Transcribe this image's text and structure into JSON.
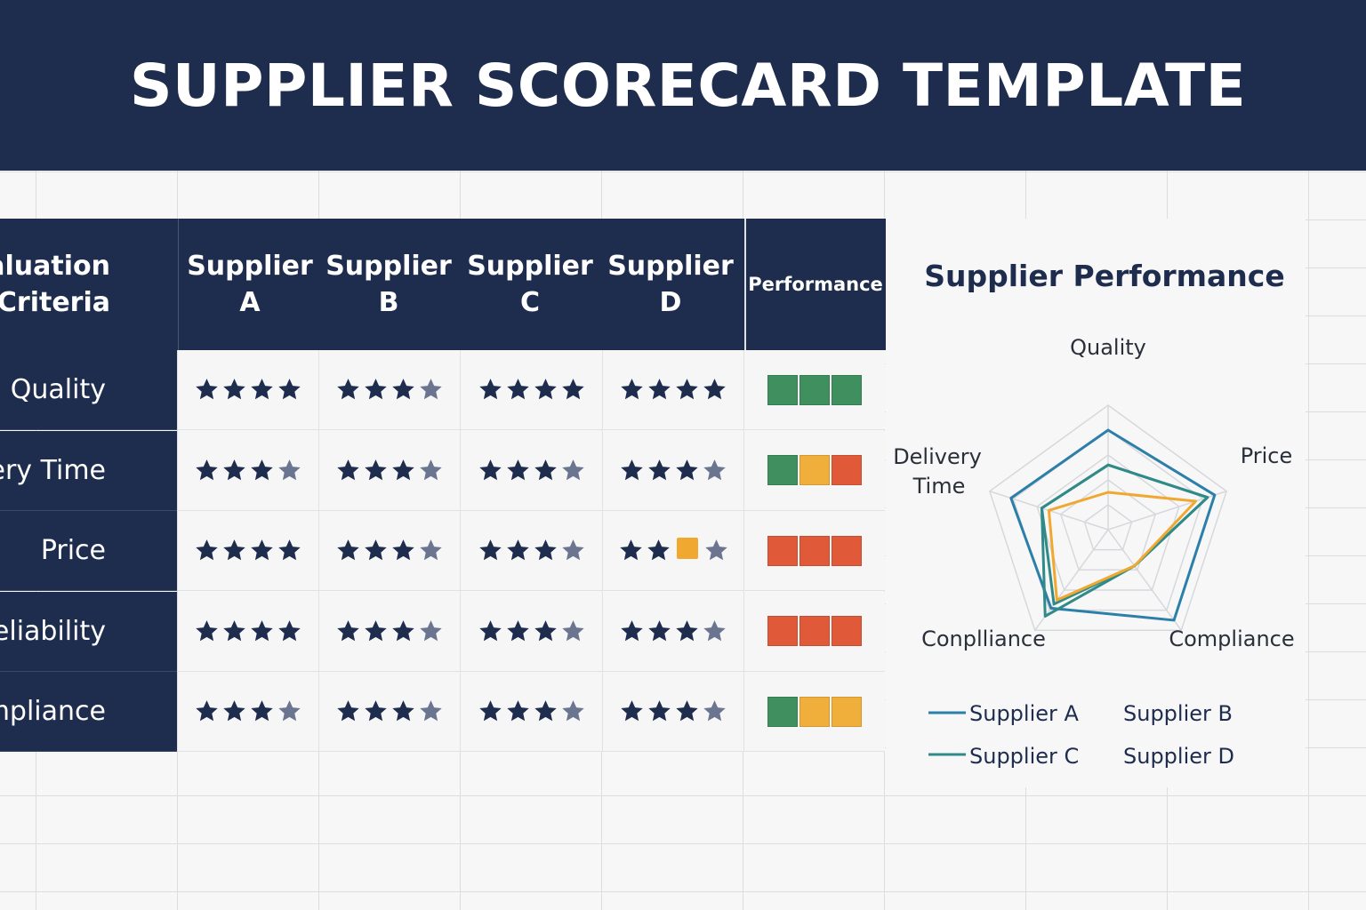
{
  "header": {
    "title": "SUPPLIER SCORECARD TEMPLATE"
  },
  "table": {
    "criteria_header": [
      "valuation",
      "Criteria"
    ],
    "suppliers": [
      {
        "line1": "Supplier",
        "line2": "A"
      },
      {
        "line1": "Supplier",
        "line2": "B"
      },
      {
        "line1": "Supplier",
        "line2": "C"
      },
      {
        "line1": "Supplier",
        "line2": "D"
      }
    ],
    "performance_header": "Performance",
    "rows": [
      {
        "label": "Quality",
        "ratings": [
          "4",
          "3.5",
          "4",
          "4"
        ],
        "performance": [
          "green",
          "green",
          "green"
        ]
      },
      {
        "label": "ivery Time",
        "ratings": [
          "3.5",
          "3.5",
          "3.5",
          "3.5"
        ],
        "performance": [
          "green",
          "amber",
          "red"
        ]
      },
      {
        "label": "Price",
        "ratings": [
          "4",
          "3.5",
          "3.5",
          "2+box+half"
        ],
        "performance": [
          "red",
          "red",
          "red"
        ]
      },
      {
        "label": "eliability",
        "ratings": [
          "4",
          "3.5",
          "3.5",
          "3.5"
        ],
        "performance": [
          "red",
          "red",
          "red"
        ]
      },
      {
        "label": "mpliance",
        "ratings": [
          "3.5",
          "3.5",
          "3.5",
          "3.5"
        ],
        "performance": [
          "green",
          "amber",
          "amber"
        ]
      }
    ]
  },
  "colors": {
    "navy": "#1e2d4d",
    "green": "#3f8f5f",
    "amber": "#f0ae3a",
    "red": "#e05a3a",
    "supplier_a": "#2b7fa8",
    "supplier_c": "#2f8a88",
    "orange_series": "#f0a830"
  },
  "chart_data": {
    "type": "radar",
    "title": "Supplier Performance",
    "axes": [
      "Quality",
      "Price",
      "Compliance",
      "Conplliance",
      "Delivery Time"
    ],
    "axis_labels": {
      "quality": "Quality",
      "price": "Price",
      "compliance_right": "Compliance",
      "compliance_left": "Conplliance",
      "delivery_line1": "Delivery",
      "delivery_line2": "Time"
    },
    "max": 5,
    "grid": true,
    "legend_position": "bottom",
    "series": [
      {
        "name": "Supplier A",
        "color": "#2b7fa8",
        "values": [
          4.0,
          4.5,
          4.5,
          3.9,
          4.1
        ]
      },
      {
        "name": "Supplier B",
        "color": "#2f8a88",
        "values": [
          2.6,
          4.2,
          1.8,
          3.7,
          2.8
        ]
      },
      {
        "name": "Supplier C",
        "color": "#2f8a88",
        "values": [
          2.6,
          4.2,
          1.8,
          4.3,
          2.8
        ]
      },
      {
        "name": "Supplier D",
        "color": "#f0a830",
        "values": [
          1.5,
          3.7,
          1.8,
          3.5,
          2.5
        ]
      }
    ],
    "legend": [
      {
        "label": "Supplier A",
        "swatch": "#2b7fa8"
      },
      {
        "label": "Supplier B",
        "swatch": ""
      },
      {
        "label": "Supplier C",
        "swatch": "#2f8a88"
      },
      {
        "label": "Supplier D",
        "swatch": ""
      }
    ]
  }
}
